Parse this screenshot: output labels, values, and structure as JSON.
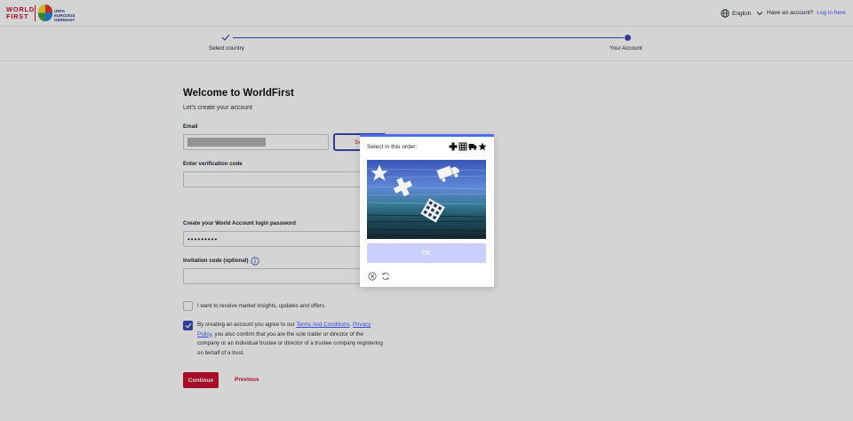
{
  "header": {
    "logo_line1": "WORLD",
    "logo_line2": "FIRST",
    "partner_logo": "UEFA EURO2024 GERMANY",
    "language": "English",
    "have_account": "Have an account?",
    "login_link": "Log in here"
  },
  "stepper": {
    "steps": [
      {
        "label": "Select country",
        "state": "completed"
      },
      {
        "label": "Your Account",
        "state": "current"
      }
    ]
  },
  "form": {
    "title": "Welcome to WorldFirst",
    "subtitle": "Let's create your account",
    "email_label": "Email",
    "send_button": "Se",
    "verification_label": "Enter verification code",
    "password_label": "Create your World Account login password",
    "password_value": "•••••••••",
    "invitation_label": "Invitation code (optional)",
    "marketing_checkbox": {
      "checked": false,
      "label": "I want to receive market insights, updates and offers."
    },
    "terms_checkbox": {
      "checked": true,
      "text_before": "By creating an account you agree to our ",
      "terms_link": "Terms And Conditions",
      "comma": ", ",
      "privacy_link": "Privacy Policy",
      "text_after": ", you also confirm that you are the sole trader or director of the company or an individual trustee or director of a trustee company registering on behalf of a trust."
    },
    "continue_button": "Continue",
    "previous_button": "Previous"
  },
  "captcha": {
    "instruction": "Select in this order:",
    "targets": [
      "cross-icon",
      "waffle-icon",
      "truck-icon",
      "star-icon"
    ],
    "ok_button": "OK",
    "icons": [
      "close-icon",
      "refresh-icon"
    ]
  },
  "colors": {
    "brand_red": "#c8102e",
    "accent_blue": "#3b4ab3",
    "captcha_accent": "#4f6cf0"
  }
}
